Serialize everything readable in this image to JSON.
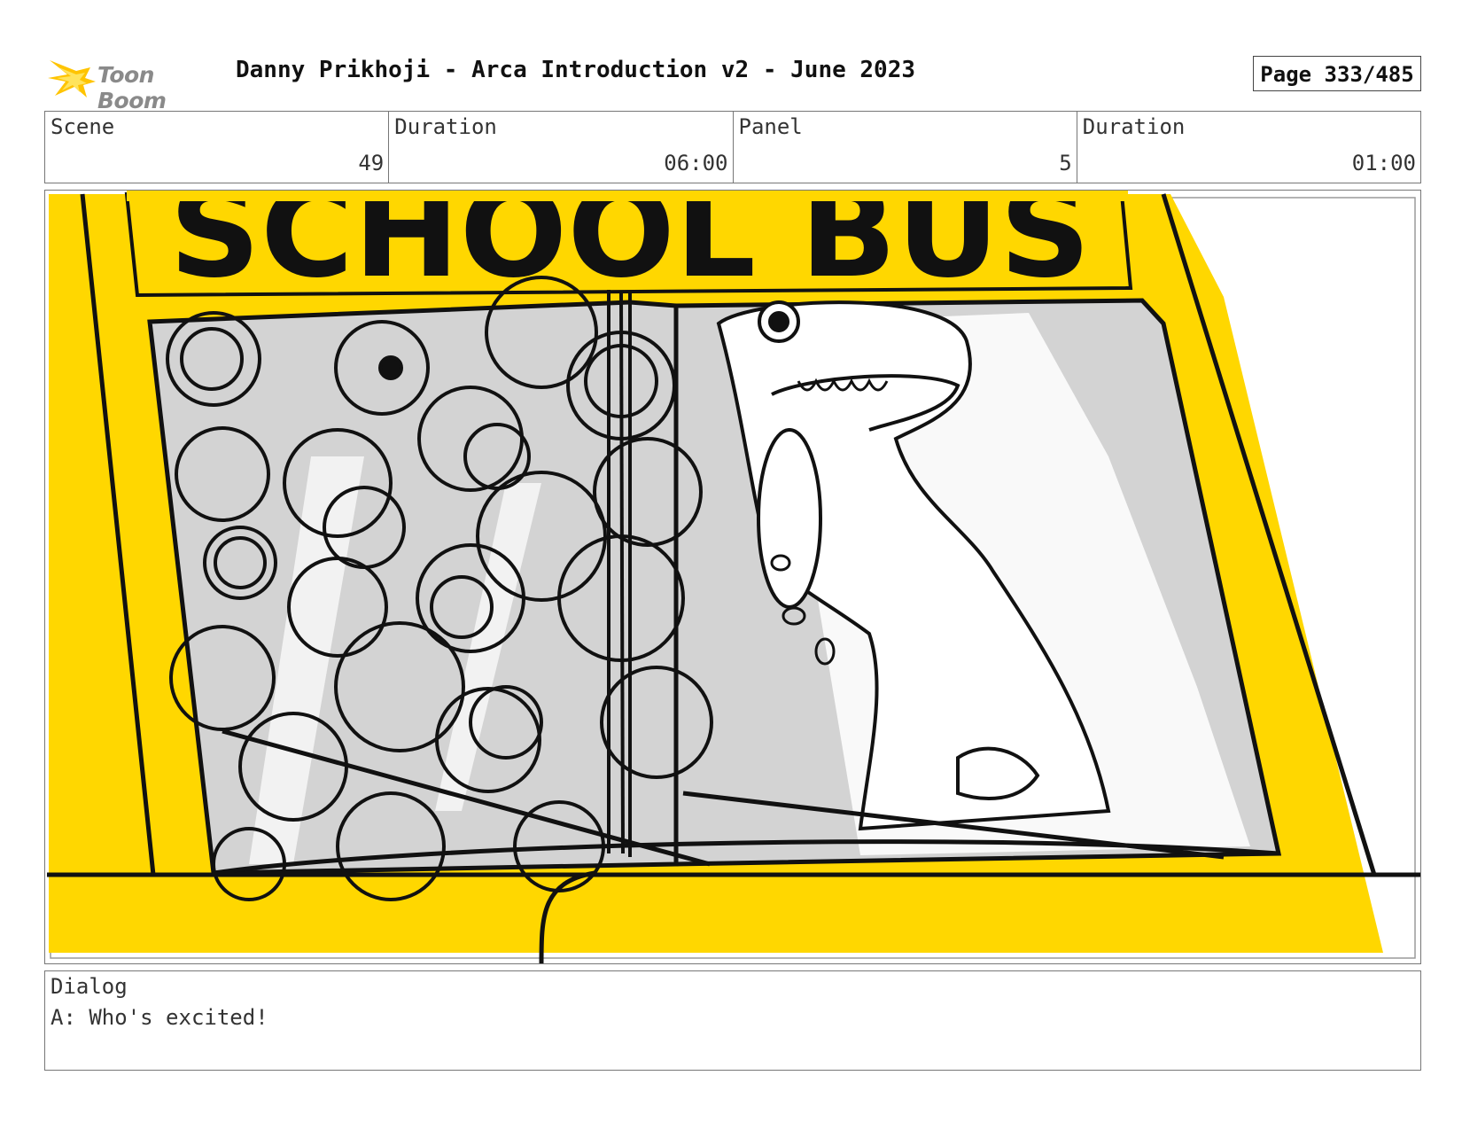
{
  "header": {
    "logo_text": "Toon Boom",
    "title": "Danny Prikhoji - Arca Introduction v2 - June 2023",
    "page": "Page 333/485"
  },
  "info": {
    "scene_label": "Scene",
    "scene_value": "49",
    "scene_duration_label": "Duration",
    "scene_duration_value": "06:00",
    "panel_label": "Panel",
    "panel_value": "5",
    "panel_duration_label": "Duration",
    "panel_duration_value": "01:00"
  },
  "panel": {
    "sign_text": "SCHOOL BUS",
    "colors": {
      "bus_yellow": "#FFD700",
      "window_grey": "#D3D3D3",
      "ink": "#111111"
    }
  },
  "dialog": {
    "label": "Dialog",
    "text": "A: Who's excited!"
  }
}
